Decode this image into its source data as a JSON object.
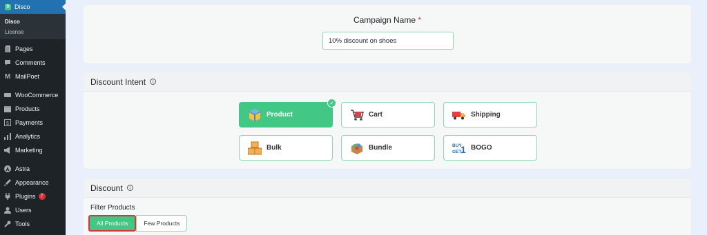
{
  "sidebar": {
    "active": {
      "label": "Disco",
      "icon": "disco-icon"
    },
    "submenu": [
      {
        "label": "Disco",
        "current": true
      },
      {
        "label": "License",
        "current": false
      }
    ],
    "items_group1": [
      {
        "label": "Pages",
        "icon": "pages-icon"
      },
      {
        "label": "Comments",
        "icon": "comments-icon"
      },
      {
        "label": "MailPoet",
        "icon": "mailpoet-icon"
      }
    ],
    "items_group2": [
      {
        "label": "WooCommerce",
        "icon": "woocommerce-icon"
      },
      {
        "label": "Products",
        "icon": "products-icon"
      },
      {
        "label": "Payments",
        "icon": "payments-icon"
      },
      {
        "label": "Analytics",
        "icon": "analytics-icon"
      },
      {
        "label": "Marketing",
        "icon": "marketing-icon"
      }
    ],
    "items_group3": [
      {
        "label": "Astra",
        "icon": "astra-icon"
      },
      {
        "label": "Appearance",
        "icon": "appearance-icon"
      },
      {
        "label": "Plugins",
        "icon": "plugins-icon",
        "badge": "7"
      },
      {
        "label": "Users",
        "icon": "users-icon"
      },
      {
        "label": "Tools",
        "icon": "tools-icon"
      }
    ]
  },
  "campaign": {
    "label": "Campaign Name",
    "required_mark": "*",
    "value": "10% discount on shoes"
  },
  "intent": {
    "title": "Discount Intent",
    "options": [
      {
        "label": "Product",
        "icon": "product-box-icon",
        "selected": true
      },
      {
        "label": "Cart",
        "icon": "cart-icon",
        "selected": false
      },
      {
        "label": "Shipping",
        "icon": "shipping-truck-icon",
        "selected": false
      },
      {
        "label": "Bulk",
        "icon": "bulk-boxes-icon",
        "selected": false
      },
      {
        "label": "Bundle",
        "icon": "bundle-icon",
        "selected": false
      },
      {
        "label": "BOGO",
        "icon": "bogo-icon",
        "selected": false
      }
    ]
  },
  "discount": {
    "title": "Discount",
    "filter_label": "Filter Products",
    "options": [
      {
        "label": "All Products",
        "selected": true
      },
      {
        "label": "Few Products",
        "selected": false
      }
    ]
  },
  "colors": {
    "accent": "#43c785",
    "sidebar_bg": "#1d2327",
    "active_bg": "#2271b1",
    "highlight": "#d63638"
  }
}
